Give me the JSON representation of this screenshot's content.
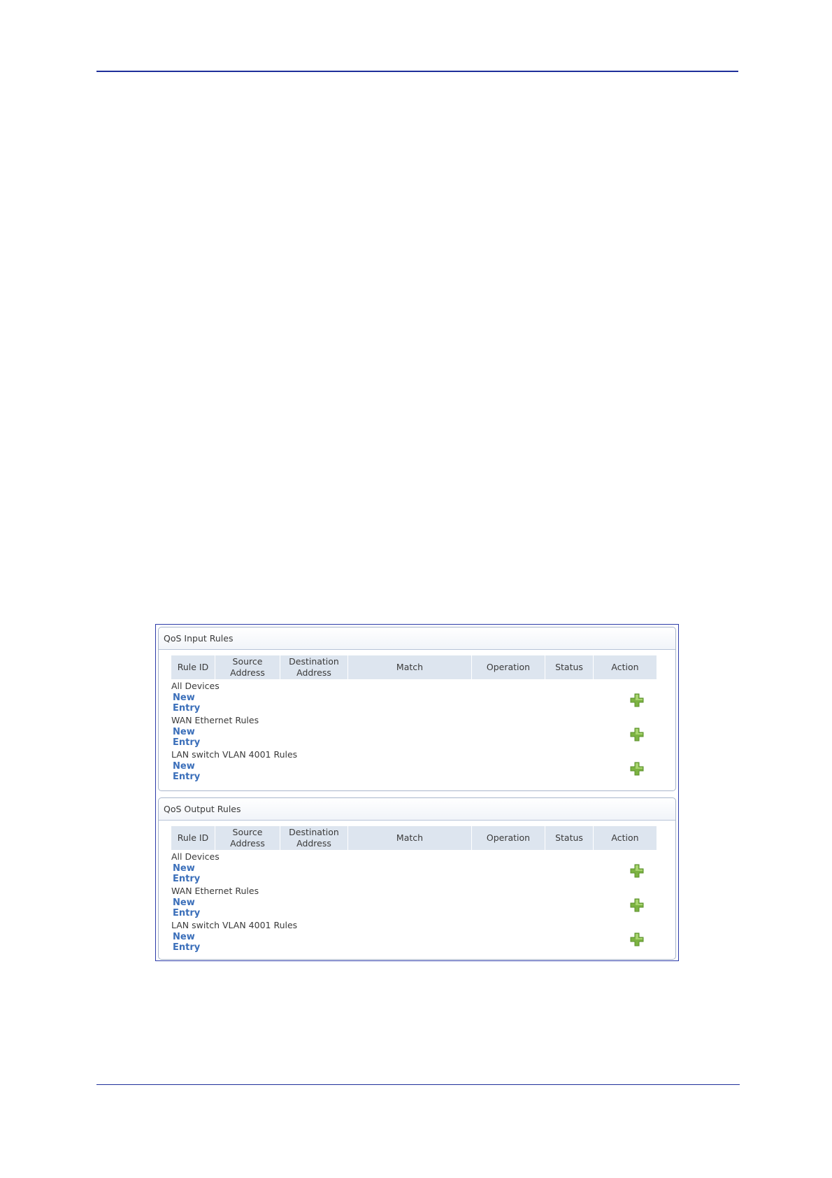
{
  "panels": [
    {
      "title": "QoS Input Rules",
      "columns": [
        "Rule ID",
        "Source Address",
        "Destination Address",
        "Match",
        "Operation",
        "Status",
        "Action"
      ],
      "groups": [
        {
          "label": "All Devices",
          "link": "New Entry",
          "action_icon": "add-icon"
        },
        {
          "label": "WAN Ethernet Rules",
          "link": "New Entry",
          "action_icon": "add-icon"
        },
        {
          "label": "LAN switch VLAN 4001 Rules",
          "link": "New Entry",
          "action_icon": "add-icon"
        }
      ]
    },
    {
      "title": "QoS Output Rules",
      "columns": [
        "Rule ID",
        "Source Address",
        "Destination Address",
        "Match",
        "Operation",
        "Status",
        "Action"
      ],
      "groups": [
        {
          "label": "All Devices",
          "link": "New Entry",
          "action_icon": "add-icon"
        },
        {
          "label": "WAN Ethernet Rules",
          "link": "New Entry",
          "action_icon": "add-icon"
        },
        {
          "label": "LAN switch VLAN 4001 Rules",
          "link": "New Entry",
          "action_icon": "add-icon"
        }
      ]
    }
  ],
  "colors": {
    "header_bg": "#dde5ef",
    "link": "#3b6fba",
    "icon_green": "#7cb342",
    "page_rule": "#1f2f9a"
  }
}
